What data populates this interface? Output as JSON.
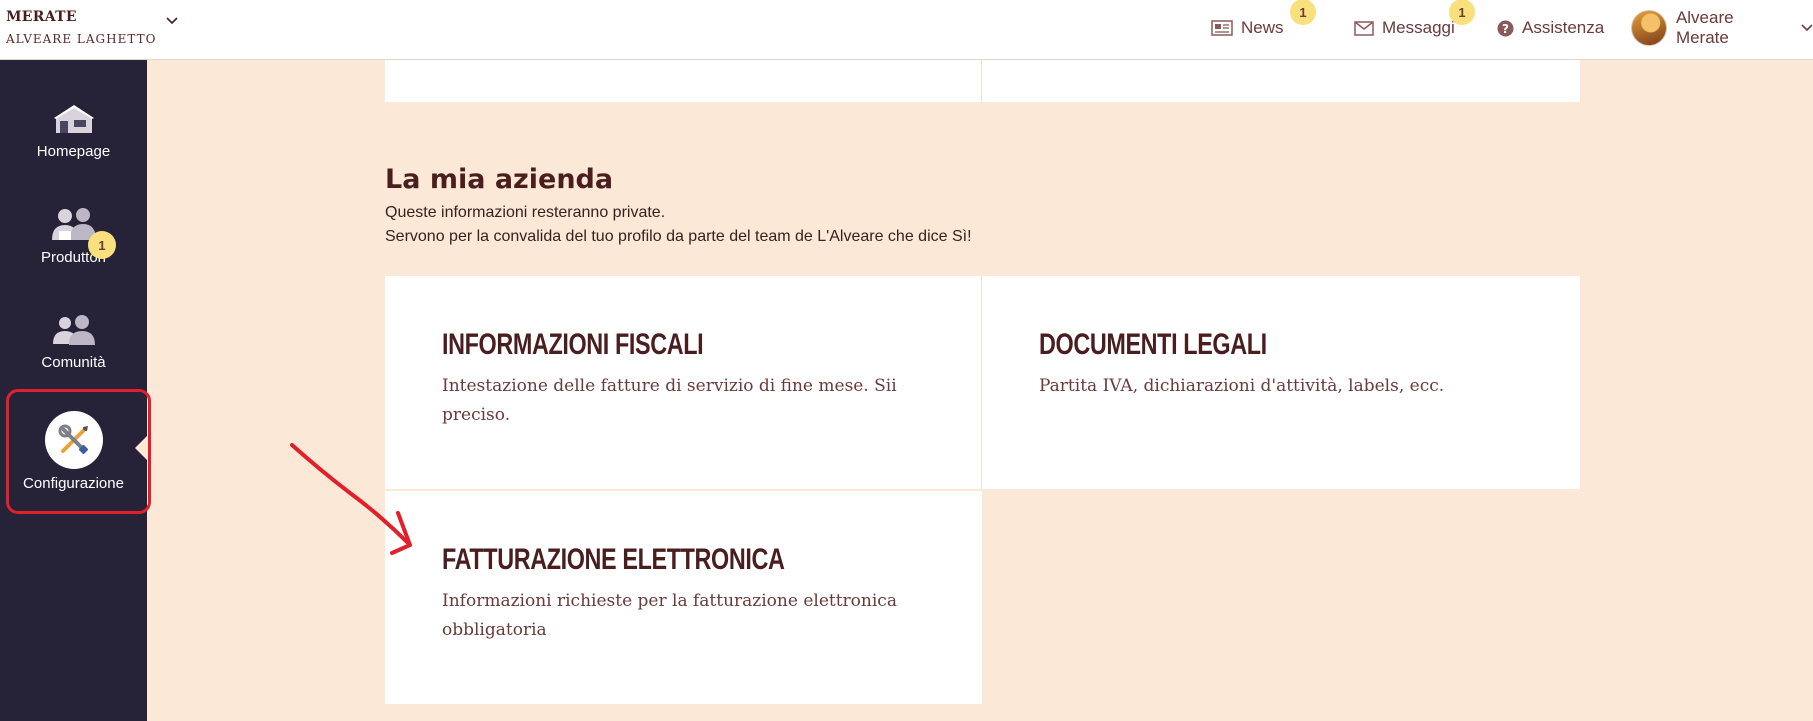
{
  "header": {
    "hive_city": "MERATE",
    "hive_name": "ALVEARE LAGHETTO",
    "nav": {
      "news": {
        "label": "News",
        "badge": "1"
      },
      "messages": {
        "label": "Messaggi",
        "badge": "1"
      },
      "help": {
        "label": "Assistenza"
      },
      "user": {
        "label": "Alveare Merate"
      }
    }
  },
  "sidebar": {
    "items": [
      {
        "label": "Homepage"
      },
      {
        "label": "Produttori",
        "badge": "1"
      },
      {
        "label": "Comunità"
      },
      {
        "label": "Configurazione",
        "active": true
      }
    ]
  },
  "main": {
    "section_title": "La mia azienda",
    "section_sub_1": "Queste informazioni resteranno private.",
    "section_sub_2": "Servono per la convalida del tuo profilo da parte del team de L'Alveare che dice Sì!",
    "cards": [
      {
        "title": "INFORMAZIONI FISCALI",
        "desc": "Intestazione delle fatture di servizio di fine mese. Sii preciso."
      },
      {
        "title": "DOCUMENTI LEGALI",
        "desc": "Partita IVA, dichiarazioni d'attività, labels, ecc."
      },
      {
        "title": "FATTURAZIONE ELETTRONICA",
        "desc": "Informazioni richieste per la fatturazione elettronica obbligatoria"
      }
    ]
  },
  "colors": {
    "page_bg": "#fbe8d6",
    "sidebar_bg": "#262339",
    "text_dark": "#4a1e1e",
    "badge": "#f9e07d",
    "annotation_red": "#e0202a"
  }
}
